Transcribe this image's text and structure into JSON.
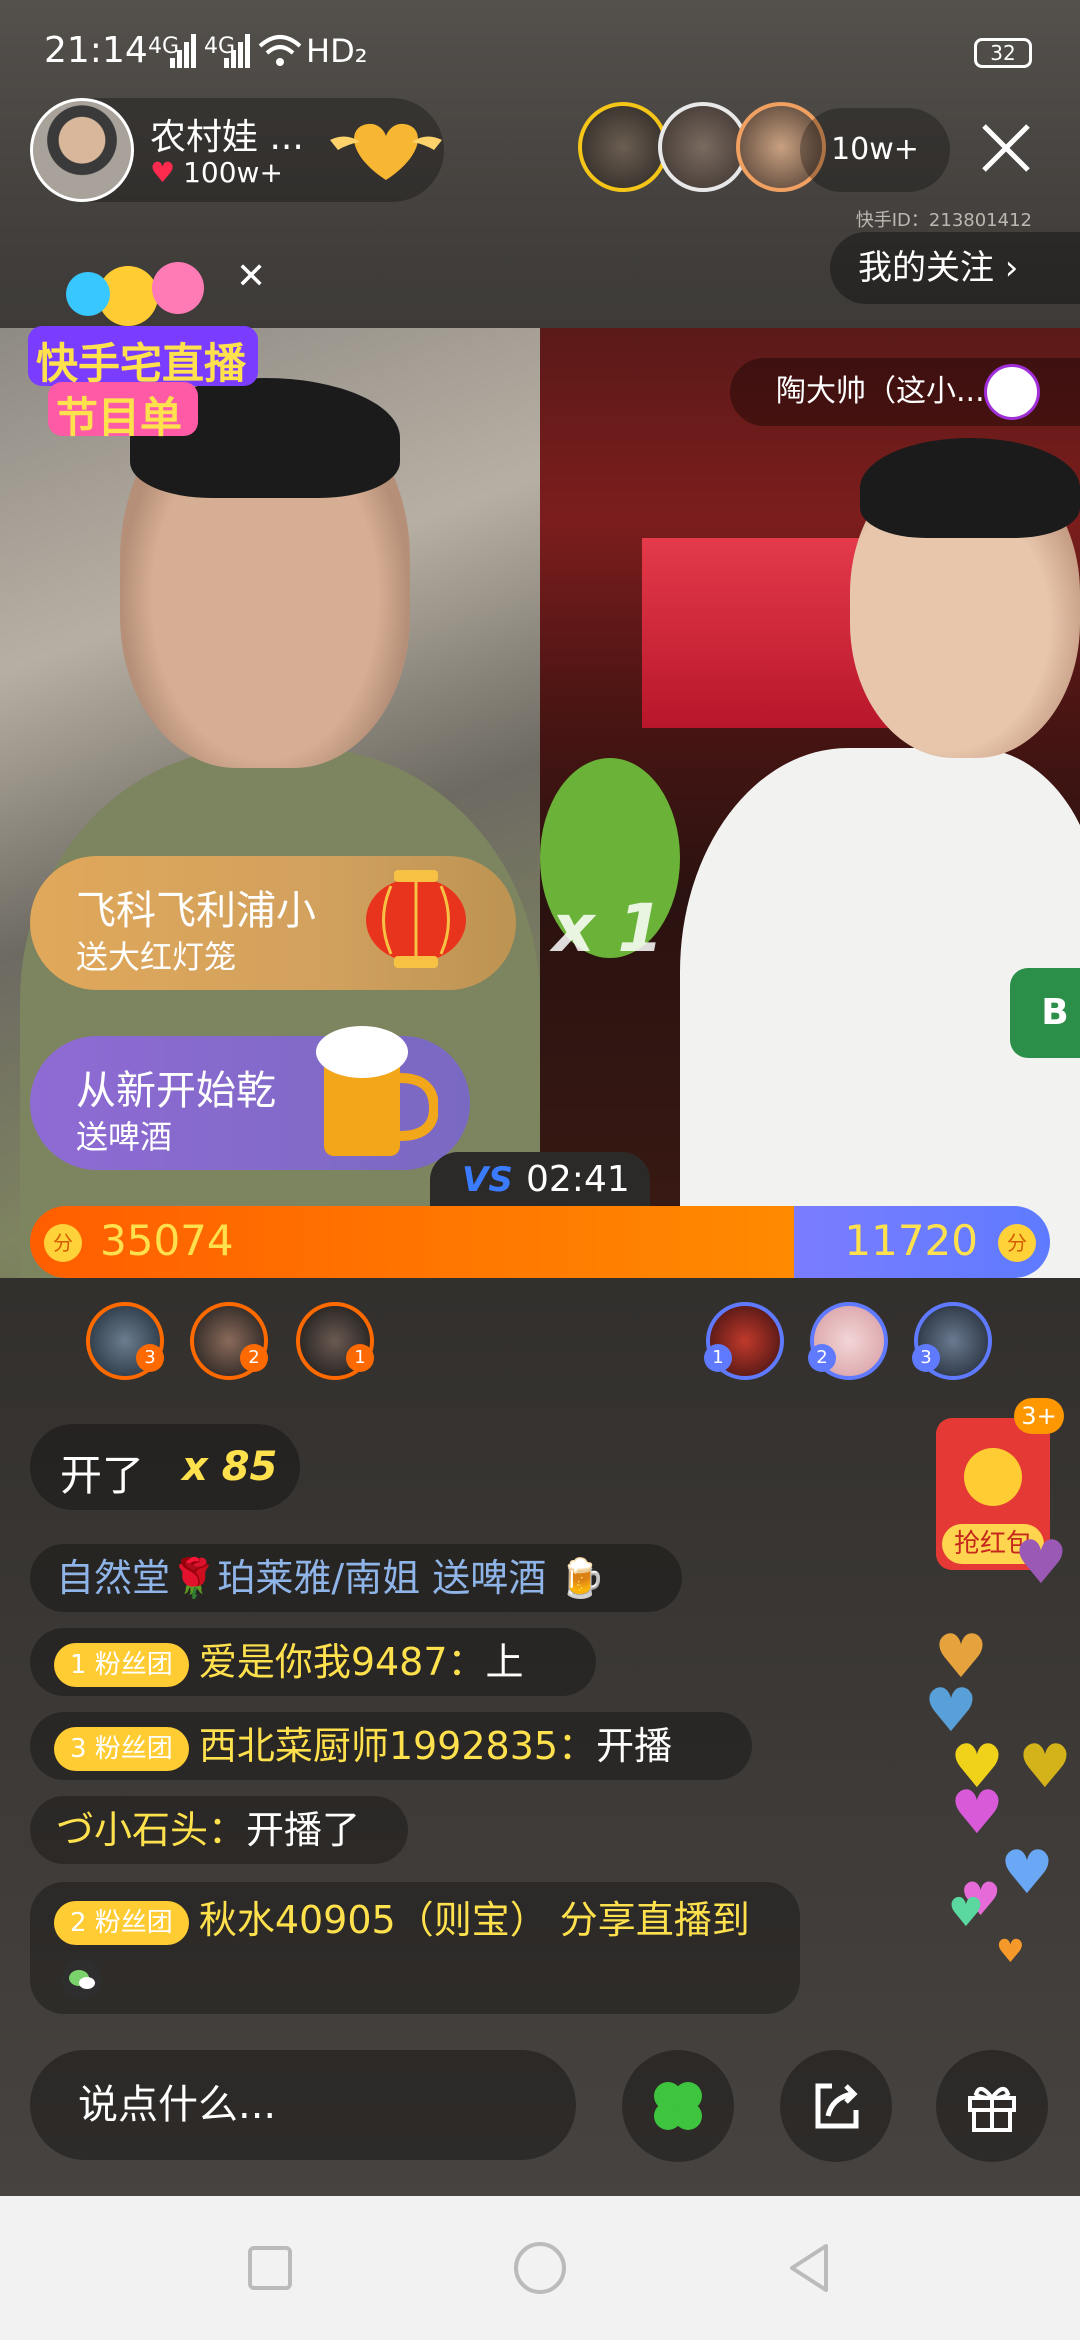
{
  "status_bar": {
    "time": "21:14",
    "signal1": "4G",
    "signal2": "4G",
    "hd": "HD₂",
    "battery": "32"
  },
  "host": {
    "name": "农村娃 ...",
    "likes": "100w+"
  },
  "viewers": {
    "count": "10w+"
  },
  "kuaishou_id": "快手ID：213801412",
  "my_follow_label": "我的关注 ›",
  "promo": {
    "line1": "快手宅直播",
    "line2": "节目单"
  },
  "pk": {
    "guest_name": "陶大帅（这小...",
    "multiplier": "x 1",
    "timer": "02:41",
    "vs_label": "VS",
    "left_score": "35074",
    "right_score": "11720",
    "left_fraction": 0.7495,
    "coin_glyph": "分"
  },
  "gifts": [
    {
      "sender": "飞科飞利浦小",
      "gift": "送大红灯笼"
    },
    {
      "sender": "从新开始乾",
      "gift": "送啤酒"
    }
  ],
  "contributors": {
    "left": [
      "3",
      "2",
      "1"
    ],
    "right": [
      "1",
      "2",
      "3"
    ]
  },
  "combo": {
    "text": "开了",
    "count": "x 85"
  },
  "chat": [
    {
      "text": "自然堂🌹珀莱雅/南姐  送啤酒 🍺"
    },
    {
      "badge": "1  粉丝团",
      "nick": "爱是你我9487：",
      "msg": "上"
    },
    {
      "badge": "3  粉丝团",
      "nick": "西北菜厨师1992835：",
      "msg": "开播"
    },
    {
      "nick": "づ小石头：",
      "msg": "开播了"
    },
    {
      "badge": "2  粉丝团",
      "nick": "秋水40905（则宝） 分享直播到",
      "msg": ""
    }
  ],
  "red_packet": {
    "label": "抢红包",
    "count": "3+"
  },
  "input_placeholder": "说点什么...",
  "colors": {
    "pk_left": "#ff6a00",
    "pk_right": "#6b7cff",
    "accent_yellow": "#ffe14d"
  }
}
